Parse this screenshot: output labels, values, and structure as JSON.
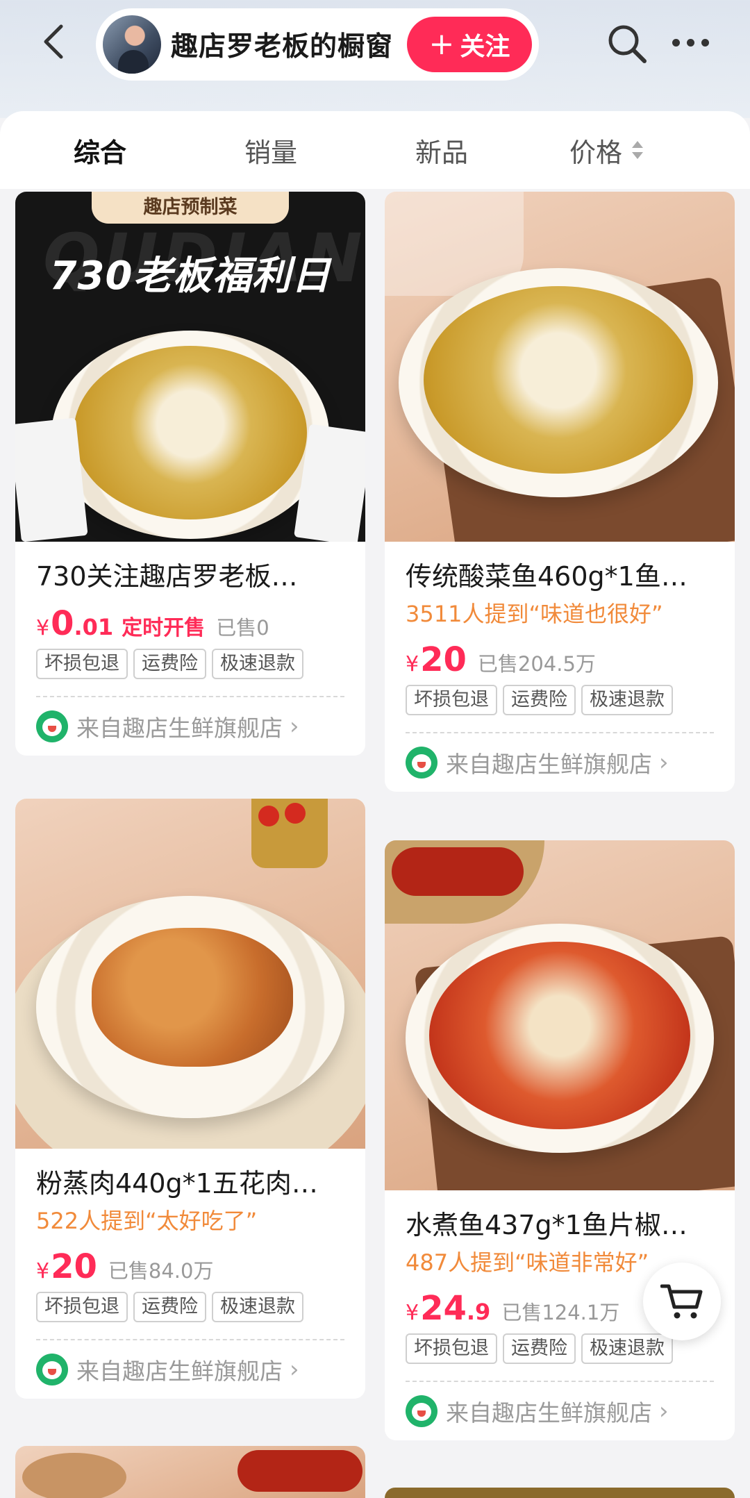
{
  "header": {
    "store_name": "趣店罗老板的橱窗",
    "follow_label": "关注"
  },
  "tabs": [
    {
      "label": "综合",
      "active": true
    },
    {
      "label": "销量",
      "active": false
    },
    {
      "label": "新品",
      "active": false
    },
    {
      "label": "价格",
      "active": false
    }
  ],
  "products": [
    {
      "title": "730关注趣店罗老板…",
      "price_int": "0",
      "price_dec": ".01",
      "price_tag": "定时开售",
      "sold": "已售0",
      "badges": [
        "坏损包退",
        "运费险",
        "极速退款"
      ],
      "source": "来自趣店生鲜旗舰店",
      "image": {
        "label": "趣店预制菜",
        "headline": "730老板福利日",
        "watermark": "QUDIAN"
      }
    },
    {
      "title": "传统酸菜鱼460g*1鱼…",
      "review": "3511人提到“味道也很好”",
      "price_int": "20",
      "sold": "已售204.5万",
      "badges": [
        "坏损包退",
        "运费险",
        "极速退款"
      ],
      "source": "来自趣店生鲜旗舰店"
    },
    {
      "title": "粉蒸肉440g*1五花肉…",
      "review": "522人提到“太好吃了”",
      "price_int": "20",
      "sold": "已售84.0万",
      "badges": [
        "坏损包退",
        "运费险",
        "极速退款"
      ],
      "source": "来自趣店生鲜旗舰店"
    },
    {
      "title": "水煮鱼437g*1鱼片椒…",
      "review": "487人提到“味道非常好”",
      "price_int": "24",
      "price_dec": ".9",
      "sold": "已售124.1万",
      "badges": [
        "坏损包退",
        "运费险",
        "极速退款"
      ],
      "source": "来自趣店生鲜旗舰店"
    }
  ],
  "currency": "¥",
  "colors": {
    "accent": "#ff2b57",
    "review": "#f18a3a",
    "source_icon": "#20b36a"
  },
  "icons": [
    "back-arrow-icon",
    "search-icon",
    "more-icon",
    "cart-icon",
    "sort-icon",
    "chevron-right-icon",
    "store-logo-icon"
  ]
}
